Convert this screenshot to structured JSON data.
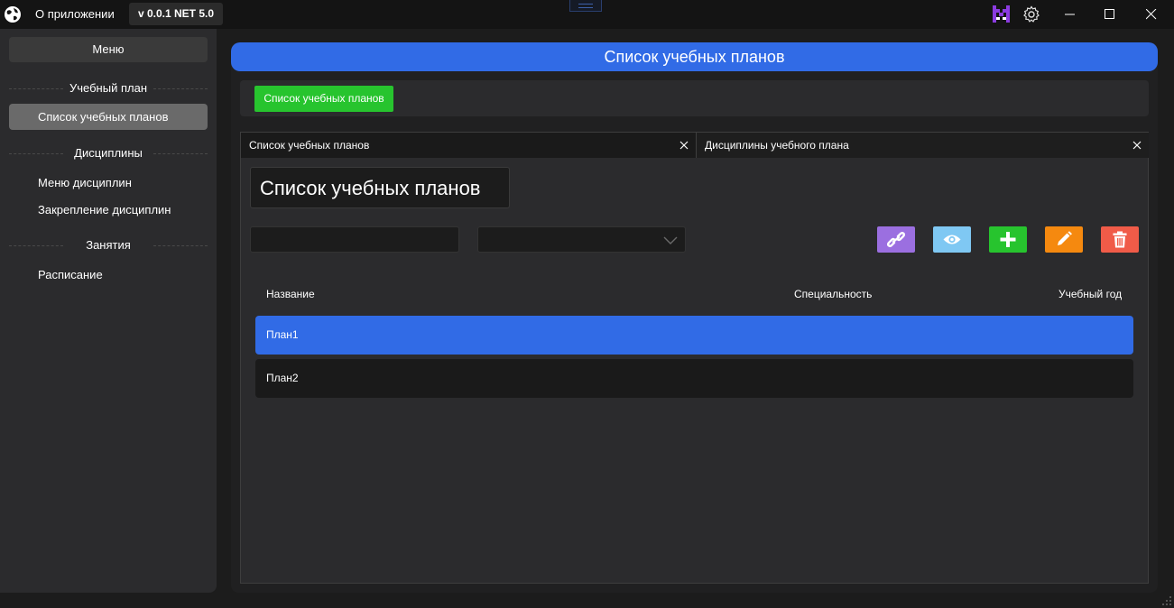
{
  "titlebar": {
    "about_label": "О приложении",
    "version_label": "v 0.0.1 NET 5.0",
    "icons": [
      "globe-icon",
      "app-logo-icon",
      "gear-icon",
      "minimize-icon",
      "maximize-icon",
      "close-icon"
    ]
  },
  "sidebar": {
    "menu_label": "Меню",
    "sections": [
      {
        "title": "Учебный план",
        "items": [
          {
            "label": "Список учебных планов",
            "active": true
          }
        ]
      },
      {
        "title": "Дисциплины",
        "items": [
          {
            "label": "Меню дисциплин"
          },
          {
            "label": "Закрепление дисциплин"
          }
        ]
      },
      {
        "title": "Занятия",
        "items": [
          {
            "label": "Расписание"
          }
        ]
      }
    ]
  },
  "main": {
    "header_title": "Список учебных планов",
    "toolbar_button_label": "Список учебных планов",
    "tabs": [
      {
        "label": "Список учебных планов",
        "active": true
      },
      {
        "label": "Дисциплины учебного плана"
      }
    ],
    "page_title": "Список учебных планов",
    "search_value": "",
    "filter_selected": "",
    "actions": [
      {
        "name": "link",
        "color": "#9b6fe0"
      },
      {
        "name": "view",
        "color": "#7fc8f3"
      },
      {
        "name": "add",
        "color": "#27c42e"
      },
      {
        "name": "edit",
        "color": "#f5890f"
      },
      {
        "name": "delete",
        "color": "#f05b48"
      }
    ],
    "table": {
      "columns": [
        "Название",
        "Специальность",
        "Учебный год"
      ],
      "rows": [
        {
          "name": "План1",
          "specialty": "",
          "year": "",
          "selected": true
        },
        {
          "name": "План2",
          "specialty": "",
          "year": "",
          "selected": false
        }
      ]
    }
  },
  "colors": {
    "accent": "#316be6",
    "green": "#27c42e",
    "background": "#1c1c1c",
    "panel": "#2b2b2d"
  }
}
